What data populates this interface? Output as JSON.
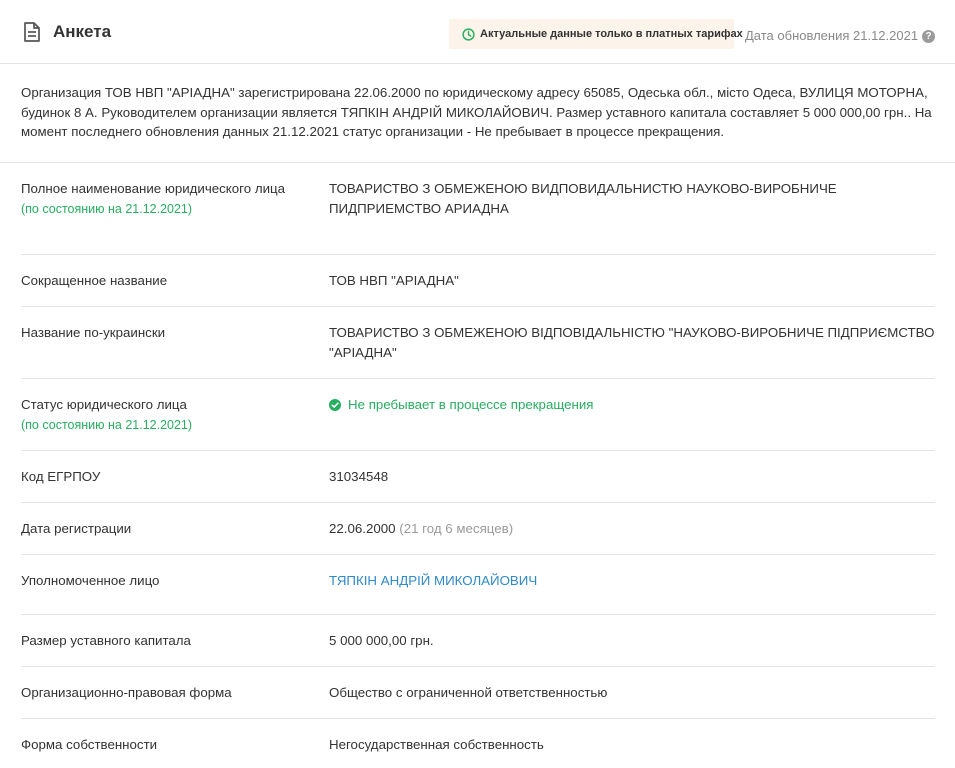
{
  "header": {
    "title": "Анкета",
    "notice_text": "Актуальные данные только в платных тарифах",
    "update_date": "Дата обновления 21.12.2021",
    "help_icon_text": "?"
  },
  "summary": "Организация ТОВ НВП \"АРІАДНА\" зарегистрирована 22.06.2000 по юридическому адресу 65085, Одеська обл., місто Одеса, ВУЛИЦЯ МОТОРНА, будинок 8 А. Руководителем организации является ТЯПКІН АНДРІЙ МИКОЛАЙОВИЧ. Размер уставного капитала составляет 5 000 000,00 грн.. На момент последнего обновления данных 21.12.2021 статус организации - Не пребывает в процессе прекращения.",
  "rows": [
    {
      "label": "Полное наименование юридического лица",
      "sublabel": "(по состоянию на 21.12.2021)",
      "value": "ТОВАРИСТВО З ОБМЕЖЕНОЮ ВИДПОВИДАЛЬНИСТЮ НАУКОВО-ВИРОБНИЧЕ ПИДПРИЕМСТВО АРИАДНА"
    },
    {
      "label": "Сокращенное название",
      "value": "ТОВ НВП \"АРІАДНА\""
    },
    {
      "label": "Название по-украински",
      "value": "ТОВАРИСТВО З ОБМЕЖЕНОЮ ВІДПОВІДАЛЬНІСТЮ \"НАУКОВО-ВИРОБНИЧЕ ПІДПРИЄМСТВО \"АРІАДНА\""
    },
    {
      "label": "Статус юридического лица",
      "sublabel": "(по состоянию на 21.12.2021)",
      "value": "Не пребывает в процессе прекращения",
      "status_color": "#27ae60"
    },
    {
      "label": "Код ЕГРПОУ",
      "value": "31034548"
    },
    {
      "label": "Дата регистрации",
      "value": "22.06.2000",
      "value_extra": "(21 год 6 месяцев)"
    },
    {
      "label": "Уполномоченное лицо",
      "value": "ТЯПКІН АНДРІЙ МИКОЛАЙОВИЧ",
      "link_color": "#2f8ac9"
    },
    {
      "label": "Размер уставного капитала",
      "value": "5 000 000,00 грн."
    },
    {
      "label": "Организационно-правовая форма",
      "value": "Общество с ограниченной ответственностью"
    },
    {
      "label": "Форма собственности",
      "value": "Негосударственная собственность"
    }
  ],
  "colors": {
    "accent_green": "#27ae60",
    "link_blue": "#2f8ac9",
    "notice_bg": "#fcf3ea"
  },
  "icons": {
    "title_icon": "document-icon",
    "notice_icon": "clock-icon",
    "help_icon": "question-icon",
    "status_icon": "check-circle-icon"
  }
}
